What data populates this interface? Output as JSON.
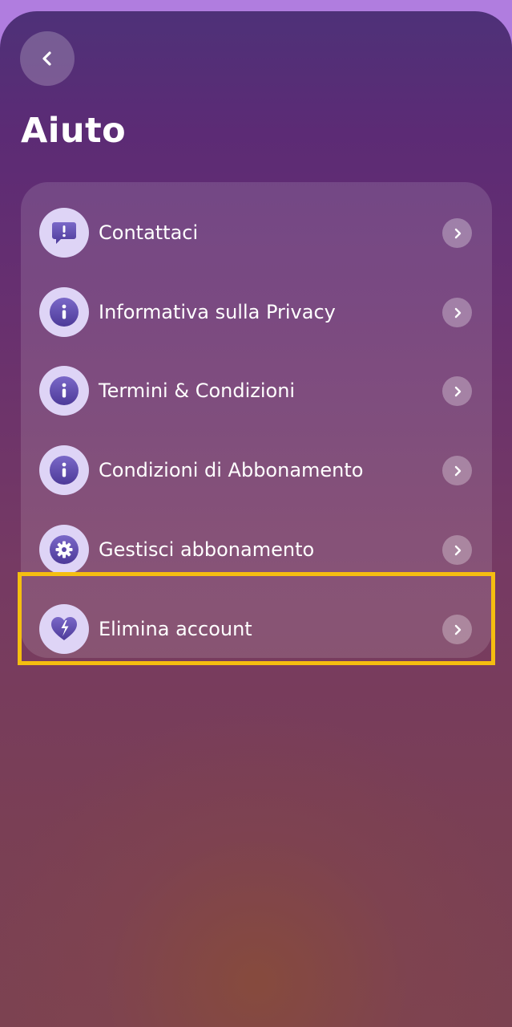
{
  "header": {
    "title": "Aiuto"
  },
  "colors": {
    "highlight": "#f5be10",
    "icon_bg": "#ded4f6",
    "icon_fg": "#5a47a8"
  },
  "menu": {
    "items": [
      {
        "label": "Contattaci",
        "icon": "alert-message-icon"
      },
      {
        "label": "Informativa sulla Privacy",
        "icon": "info-icon"
      },
      {
        "label": "Termini & Condizioni",
        "icon": "info-icon"
      },
      {
        "label": "Condizioni di Abbonamento",
        "icon": "info-icon"
      },
      {
        "label": "Gestisci abbonamento",
        "icon": "gear-icon"
      },
      {
        "label": "Elimina account",
        "icon": "broken-heart-icon"
      }
    ]
  }
}
